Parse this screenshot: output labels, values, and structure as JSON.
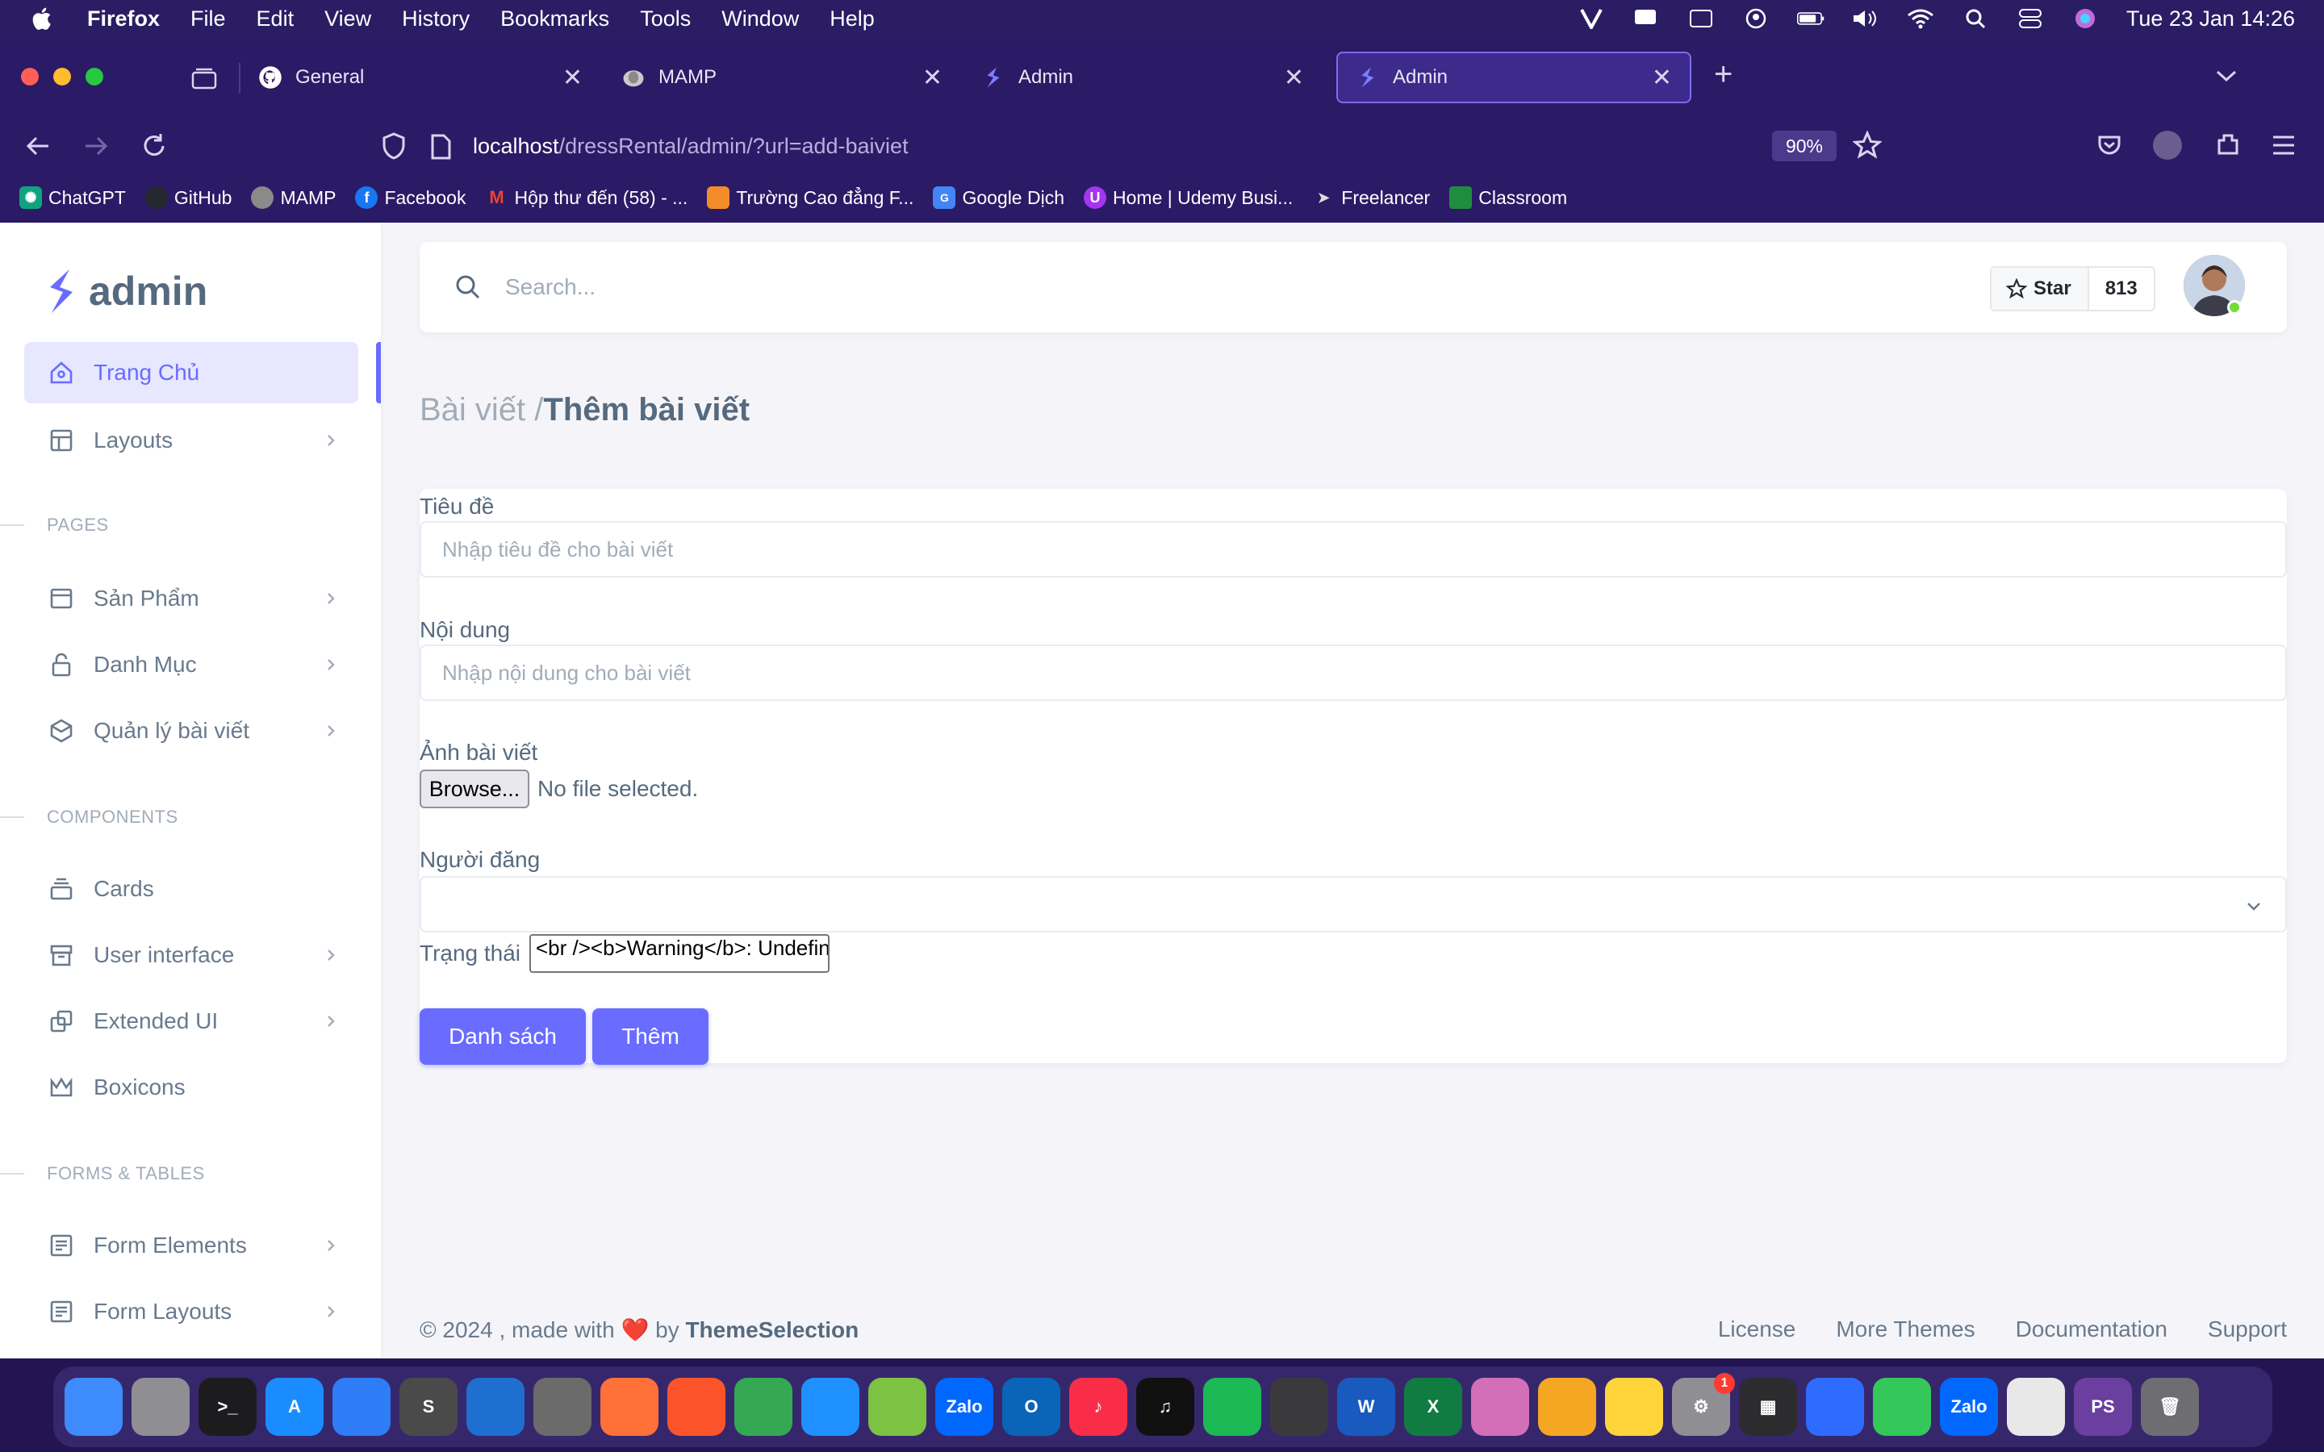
{
  "menubar": {
    "app": "Firefox",
    "items": [
      "File",
      "Edit",
      "View",
      "History",
      "Bookmarks",
      "Tools",
      "Window",
      "Help"
    ],
    "clock": "Tue 23 Jan  14:26"
  },
  "tabs": [
    {
      "label": "General",
      "icon": "github-icon"
    },
    {
      "label": "MAMP",
      "icon": "mamp-icon"
    },
    {
      "label": "Admin",
      "icon": "sneat-icon"
    },
    {
      "label": "Admin",
      "icon": "sneat-icon",
      "active": true
    }
  ],
  "urlbar": {
    "host": "localhost",
    "path": "/dressRental/admin/?url=add-baiviet",
    "zoom": "90%"
  },
  "bookmarks": [
    {
      "label": "ChatGPT",
      "color": "#10a37f"
    },
    {
      "label": "GitHub",
      "color": "#24292f"
    },
    {
      "label": "MAMP",
      "color": "#777"
    },
    {
      "label": "Facebook",
      "color": "#1877f2"
    },
    {
      "label": "Hộp thư đến (58) - ...",
      "color": "#ea4335"
    },
    {
      "label": "Trường Cao đẳng F...",
      "color": "#f28c28"
    },
    {
      "label": "Google Dịch",
      "color": "#4285f4"
    },
    {
      "label": "Home | Udemy Busi...",
      "color": "#a435f0"
    },
    {
      "label": "Freelancer",
      "color": "#29b2fe"
    },
    {
      "label": "Classroom",
      "color": "#1e8e3e"
    }
  ],
  "sidebar": {
    "brand": "admin",
    "home": "Trang Chủ",
    "layouts": "Layouts",
    "section_pages": "PAGES",
    "products": "Sản Phẩm",
    "categories": "Danh Mục",
    "posts": "Quản lý bài viết",
    "section_components": "COMPONENTS",
    "cards": "Cards",
    "ui": "User interface",
    "extended_ui": "Extended UI",
    "boxicons": "Boxicons",
    "section_forms": "FORMS & TABLES",
    "form_elements": "Form Elements",
    "form_layouts": "Form Layouts"
  },
  "topbar": {
    "search_placeholder": "Search...",
    "star_label": "Star",
    "star_count": "813"
  },
  "breadcrumb": {
    "parent": "Bài viết /",
    "current": "Thêm bài viết"
  },
  "form": {
    "title_label": "Tiêu đề",
    "title_placeholder": "Nhập tiêu đề cho bài viết",
    "content_label": "Nội dung",
    "content_placeholder": "Nhập nội dung cho bài viết",
    "image_label": "Ảnh bài viết",
    "browse_label": "Browse...",
    "file_status": "No file selected.",
    "author_label": "Người đăng",
    "status_label": "Trạng thái",
    "status_value": "<br /><b>Warning</b>:  Undefined",
    "list_button": "Danh sách",
    "add_button": "Thêm"
  },
  "footer": {
    "copyright": "© 2024 , made with",
    "heart": "❤️",
    "by": "by",
    "brand": "ThemeSelection",
    "links": [
      "License",
      "More Themes",
      "Documentation",
      "Support"
    ]
  },
  "dock": [
    {
      "name": "finder-icon",
      "color": "#3d8bfd",
      "label": ""
    },
    {
      "name": "launchpad-icon",
      "color": "#8e8e93",
      "label": ""
    },
    {
      "name": "terminal-icon",
      "color": "#1c1c1e",
      "label": ">_"
    },
    {
      "name": "app-store-icon",
      "color": "#1a8cff",
      "label": "A"
    },
    {
      "name": "xcode-icon",
      "color": "#2e7cf6",
      "label": ""
    },
    {
      "name": "sublime-icon",
      "color": "#4a4a4a",
      "label": "S"
    },
    {
      "name": "vscode-icon",
      "color": "#1f6fd1",
      "label": ""
    },
    {
      "name": "mamp-icon",
      "color": "#6b6b6b",
      "label": ""
    },
    {
      "name": "firefox-icon",
      "color": "#ff7139",
      "label": ""
    },
    {
      "name": "brave-icon",
      "color": "#fb542b",
      "label": ""
    },
    {
      "name": "chrome-icon",
      "color": "#34a853",
      "label": ""
    },
    {
      "name": "safari-icon",
      "color": "#1e90ff",
      "label": ""
    },
    {
      "name": "coccoc-icon",
      "color": "#7cc243",
      "label": ""
    },
    {
      "name": "zalo-icon",
      "color": "#0068ff",
      "label": "Zalo"
    },
    {
      "name": "outlook-icon",
      "color": "#0a64b8",
      "label": "O"
    },
    {
      "name": "music-icon",
      "color": "#fa2d48",
      "label": "♪"
    },
    {
      "name": "capcut-icon",
      "color": "#111",
      "label": "♫"
    },
    {
      "name": "spotify-icon",
      "color": "#1db954",
      "label": ""
    },
    {
      "name": "screenshot-icon",
      "color": "#3a3a3c",
      "label": ""
    },
    {
      "name": "word-icon",
      "color": "#185abd",
      "label": "W"
    },
    {
      "name": "excel-icon",
      "color": "#107c41",
      "label": "X"
    },
    {
      "name": "imac-icon",
      "color": "#d36fb7",
      "label": ""
    },
    {
      "name": "garageband-icon",
      "color": "#f5a623",
      "label": ""
    },
    {
      "name": "notes-icon",
      "color": "#ffd43b",
      "label": ""
    },
    {
      "name": "settings-icon",
      "color": "#8e8e93",
      "label": "⚙",
      "badge": "1"
    },
    {
      "name": "calculator-icon",
      "color": "#2c2c2e",
      "label": "▦"
    },
    {
      "name": "arc-icon",
      "color": "#2e6bff",
      "label": ""
    },
    {
      "name": "facetime-icon",
      "color": "#34c759",
      "label": ""
    },
    {
      "name": "zalo-icon-2",
      "color": "#0068ff",
      "label": "Zalo"
    },
    {
      "name": "textedit-icon",
      "color": "#e8e8e8",
      "label": ""
    },
    {
      "name": "phpstorm-icon",
      "color": "#6b3fa0",
      "label": "PS"
    },
    {
      "name": "trash-icon",
      "color": "#6d6d72",
      "label": "🗑"
    }
  ],
  "colors": {
    "primary": "#696cff",
    "text": "#566a7f",
    "muted": "#a1acb8"
  }
}
